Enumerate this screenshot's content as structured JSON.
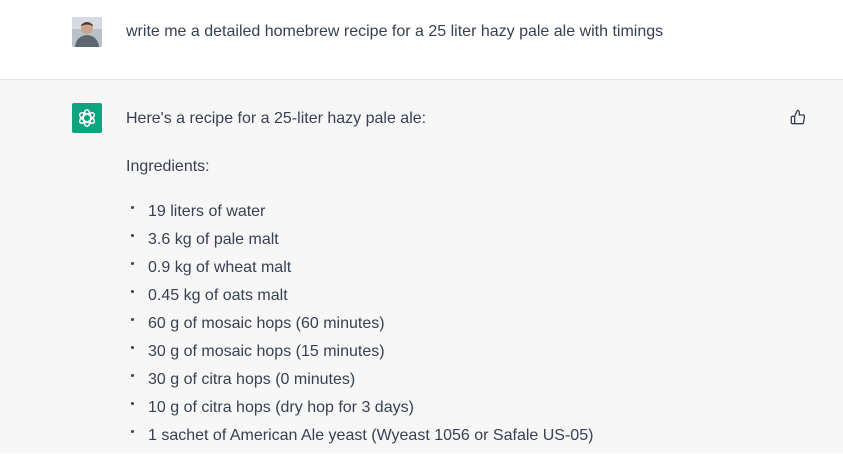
{
  "user_message": {
    "text": "write me a detailed homebrew recipe for a 25 liter hazy pale ale with timings"
  },
  "assistant_message": {
    "intro": "Here's a recipe for a 25-liter hazy pale ale:",
    "ingredients_heading": "Ingredients:",
    "ingredients": [
      "19 liters of water",
      "3.6 kg of pale malt",
      "0.9 kg of wheat malt",
      "0.45 kg of oats malt",
      "60 g of mosaic hops (60 minutes)",
      "30 g of mosaic hops (15 minutes)",
      "30 g of citra hops (0 minutes)",
      "10 g of citra hops (dry hop for 3 days)",
      "1 sachet of American Ale yeast (Wyeast 1056 or Safale US-05)"
    ]
  },
  "icons": {
    "user_avatar": "user-avatar-photo",
    "assistant_avatar": "openai-logo-icon",
    "feedback": "thumbs-up-icon"
  },
  "colors": {
    "assistant_background": "#f7f7f8",
    "assistant_avatar": "#10a37f",
    "text": "#374151"
  }
}
